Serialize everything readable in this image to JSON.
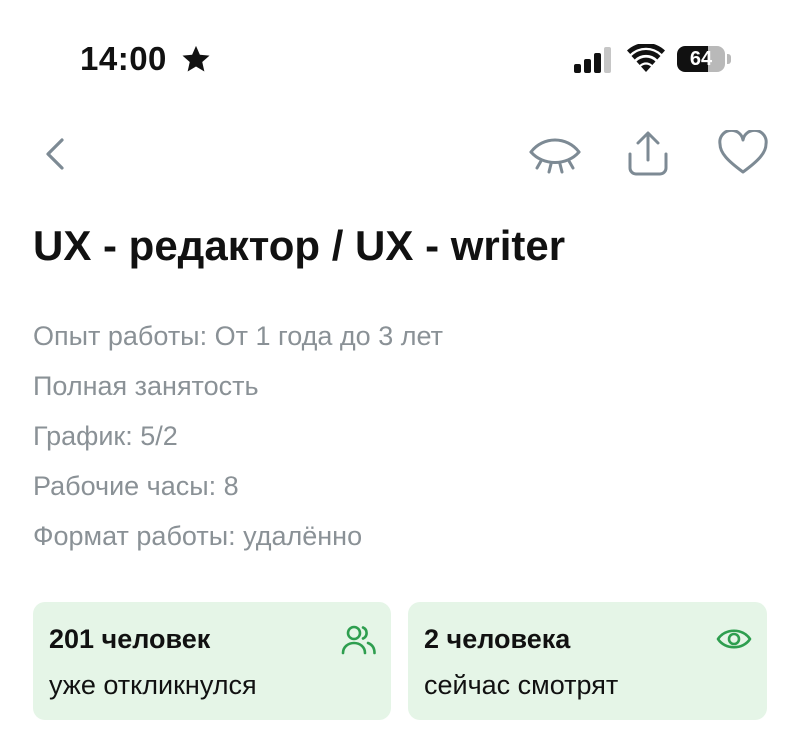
{
  "status_bar": {
    "time": "14:00",
    "battery_percent": "64",
    "battery_level": 0.64,
    "icons": [
      "star-icon",
      "signal-icon",
      "wifi-icon",
      "battery-icon"
    ]
  },
  "nav": {
    "icons": [
      "back-icon",
      "eye-off-icon",
      "share-icon",
      "heart-icon"
    ]
  },
  "vacancy": {
    "title": "UX - редактор / UX - writer",
    "details": [
      "Опыт работы: От 1 года до 3 лет",
      "Полная занятость",
      "График: 5/2",
      "Рабочие часы: 8",
      "Формат работы: удалённо"
    ]
  },
  "stats": {
    "responded": {
      "title": "201 человек",
      "subtitle": "уже откликнулся",
      "icon": "people-icon"
    },
    "watching": {
      "title": "2 человека",
      "subtitle": "сейчас смотрят",
      "icon": "eye-icon"
    }
  },
  "colors": {
    "accent_green": "#2e9e4f",
    "card_bg": "#e5f5e7",
    "muted_text": "#8a9196",
    "icon_gray": "#7d8a94"
  }
}
